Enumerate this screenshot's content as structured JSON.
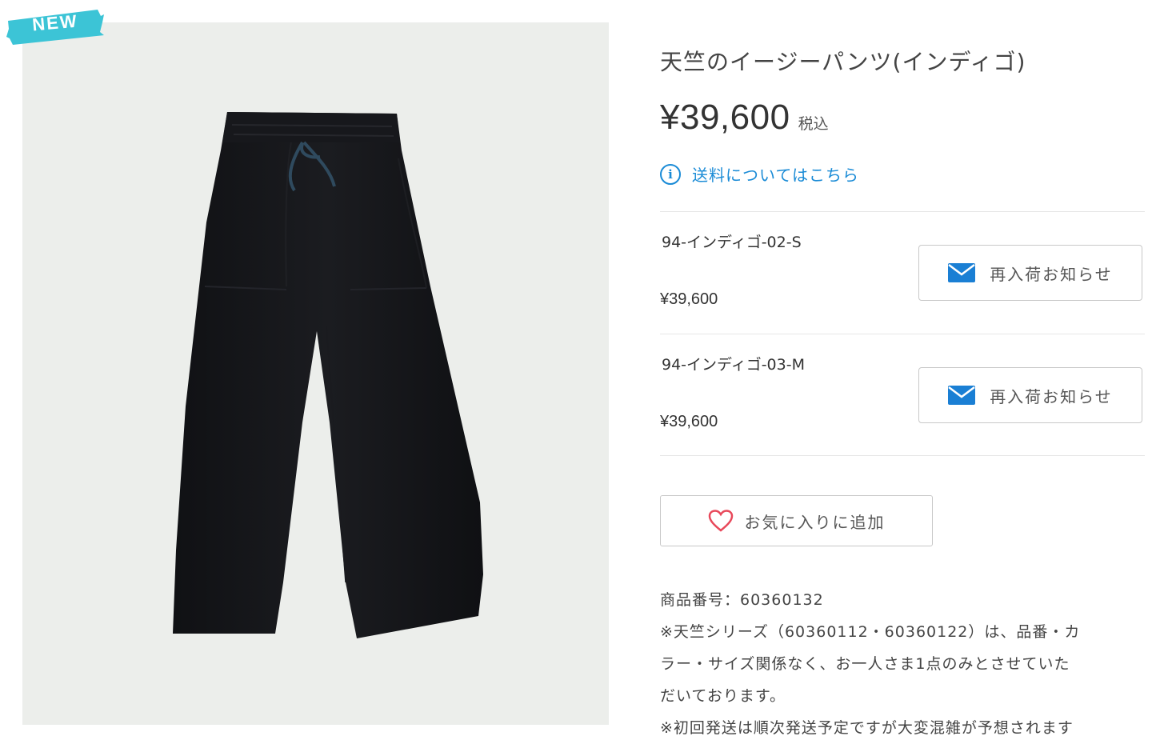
{
  "badge": {
    "label": "NEW",
    "color": "#3cc4d6"
  },
  "product_image": {
    "alt_icon": "pants-photo"
  },
  "product": {
    "title": "天竺のイージーパンツ(インディゴ)",
    "price": "¥39,600",
    "tax_label": "税込",
    "shipping_link": "送料についてはこちら"
  },
  "variants": [
    {
      "name": "94-インディゴ-02-S",
      "price": "¥39,600",
      "button_label": "再入荷お知らせ"
    },
    {
      "name": "94-インディゴ-03-M",
      "price": "¥39,600",
      "button_label": "再入荷お知らせ"
    }
  ],
  "favorite": {
    "label": "お気に入りに追加"
  },
  "description": {
    "lines": [
      "商品番号：60360132",
      "※天竺シリーズ（60360112・60360122）は、品番・カ",
      "ラー・サイズ関係なく、お一人さま1点のみとさせていた",
      "だいております。",
      "※初回発送は順次発送予定ですが大変混雑が予想されます"
    ]
  },
  "colors": {
    "link": "#1a8bd6",
    "mail_icon": "#1a7fd4",
    "heart_icon": "#e8485a",
    "image_bg": "#eceeeb",
    "pants": "#141518"
  }
}
